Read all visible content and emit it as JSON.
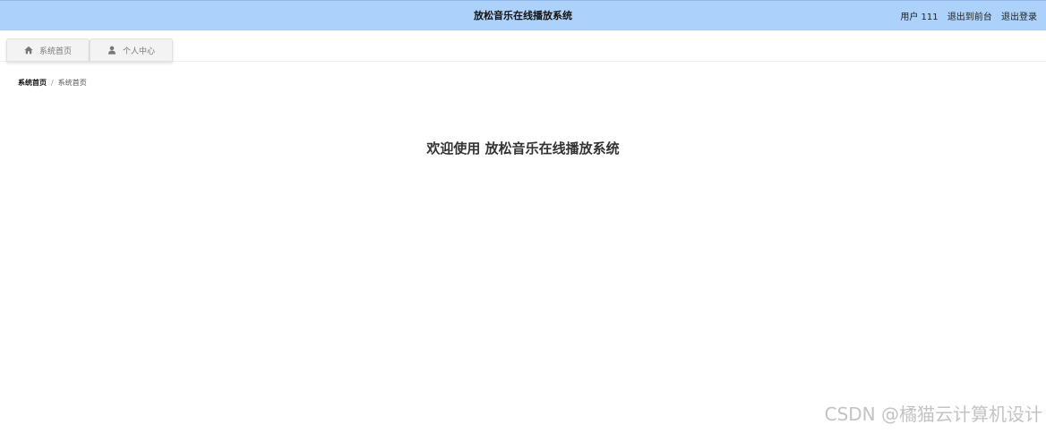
{
  "header": {
    "title": "放松音乐在线播放系统",
    "user_text": "用户 111",
    "exit_frontend": "退出到前台",
    "logout": "退出登录"
  },
  "nav": {
    "items": [
      {
        "label": "系统首页",
        "icon": "home-icon"
      },
      {
        "label": "个人中心",
        "icon": "user-icon"
      }
    ]
  },
  "breadcrumb": {
    "first": "系统首页",
    "separator": "/",
    "current": "系统首页"
  },
  "main": {
    "welcome": "欢迎使用 放松音乐在线播放系统"
  },
  "watermark": "CSDN @橘猫云计算机设计",
  "colors": {
    "header_bg": "#acd2fc",
    "tab_bg": "#f3f3f3",
    "text": "#333333"
  }
}
